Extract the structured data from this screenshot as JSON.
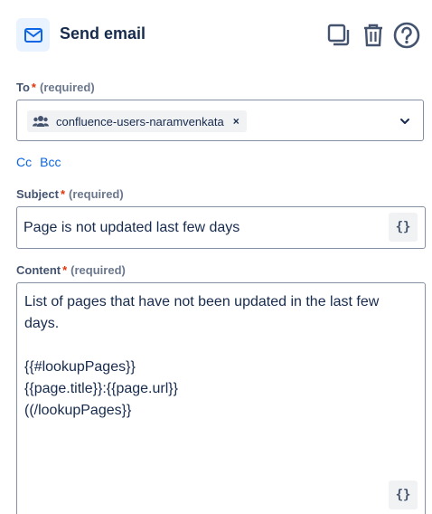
{
  "header": {
    "title": "Send email",
    "icons": [
      "mail-icon",
      "duplicate-icon",
      "trash-icon",
      "help-icon"
    ]
  },
  "to": {
    "label": "To",
    "required_mark": "*",
    "required_text": "(required)",
    "selected": [
      {
        "icon": "people-group-icon",
        "text": "confluence-users-naramvenkata",
        "remove": "×"
      }
    ]
  },
  "links": {
    "cc": "Cc",
    "bcc": "Bcc"
  },
  "subject": {
    "label": "Subject",
    "required_mark": "*",
    "required_text": "(required)",
    "value": "Page is not updated last few days",
    "smart_value_button": "{}"
  },
  "content": {
    "label": "Content",
    "required_mark": "*",
    "required_text": "(required)",
    "lines": [
      "List of pages that have not been updated in the last few",
      "days.",
      "",
      "{{#lookupPages}}",
      "{{page.title}}:{{page.url}}",
      "((/lookupPages}}"
    ],
    "smart_value_button": "{}"
  },
  "colors": {
    "accent": "#0c66e4",
    "required": "#de350b",
    "text": "#172b4d",
    "border": "#8590a2",
    "icon_tile_bg": "#e9f2ff"
  }
}
